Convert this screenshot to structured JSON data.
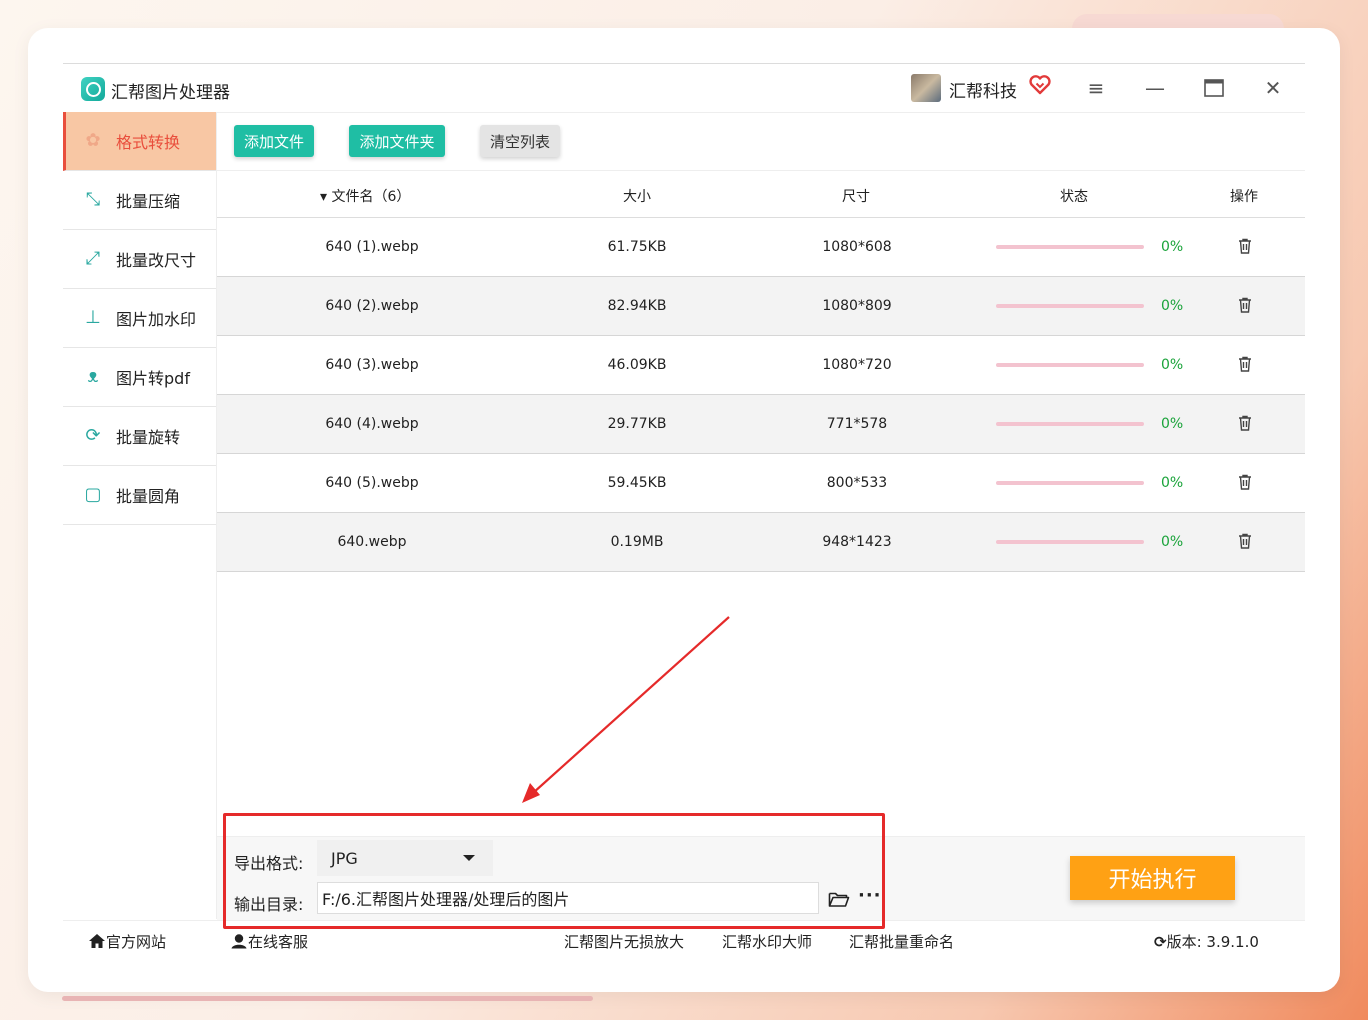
{
  "app": {
    "title": "汇帮图片处理器"
  },
  "user": {
    "name": "汇帮科技"
  },
  "sidebar": {
    "items": [
      {
        "label": "格式转换",
        "icon": "format-convert-icon",
        "active": true
      },
      {
        "label": "批量压缩",
        "icon": "compress-icon"
      },
      {
        "label": "批量改尺寸",
        "icon": "resize-icon"
      },
      {
        "label": "图片加水印",
        "icon": "watermark-icon"
      },
      {
        "label": "图片转pdf",
        "icon": "pdf-icon"
      },
      {
        "label": "批量旋转",
        "icon": "rotate-icon"
      },
      {
        "label": "批量圆角",
        "icon": "round-corner-icon"
      }
    ]
  },
  "toolbar": {
    "add_file": "添加文件",
    "add_folder": "添加文件夹",
    "clear_list": "清空列表"
  },
  "table": {
    "headers": {
      "name": "文件名（6）",
      "size": "大小",
      "dimensions": "尺寸",
      "status": "状态",
      "action": "操作"
    },
    "rows": [
      {
        "name": "640 (1).webp",
        "size": "61.75KB",
        "dimensions": "1080*608",
        "progress": "0%"
      },
      {
        "name": "640 (2).webp",
        "size": "82.94KB",
        "dimensions": "1080*809",
        "progress": "0%"
      },
      {
        "name": "640 (3).webp",
        "size": "46.09KB",
        "dimensions": "1080*720",
        "progress": "0%"
      },
      {
        "name": "640 (4).webp",
        "size": "29.77KB",
        "dimensions": "771*578",
        "progress": "0%"
      },
      {
        "name": "640 (5).webp",
        "size": "59.45KB",
        "dimensions": "800*533",
        "progress": "0%"
      },
      {
        "name": "640.webp",
        "size": "0.19MB",
        "dimensions": "948*1423",
        "progress": "0%"
      }
    ]
  },
  "bottom": {
    "format_label": "导出格式:",
    "format_value": "JPG",
    "output_label": "输出目录:",
    "output_path": "F:/6.汇帮图片处理器/处理后的图片",
    "more": "···",
    "start": "开始执行"
  },
  "footer": {
    "website": "官方网站",
    "support": "在线客服",
    "link1": "汇帮图片无损放大",
    "link2": "汇帮水印大师",
    "link3": "汇帮批量重命名",
    "version": "版本: 3.9.1.0"
  },
  "colors": {
    "accent": "#1fbea4",
    "active_tab": "#e94e3c",
    "start": "#ffa114",
    "annotation": "#e52a2a"
  }
}
